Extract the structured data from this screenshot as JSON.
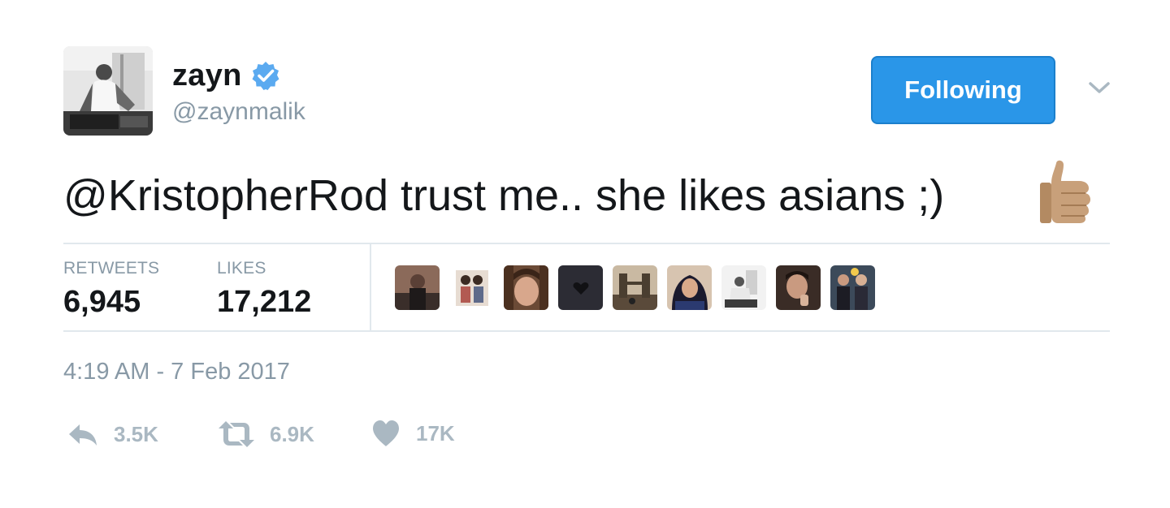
{
  "author": {
    "display_name": "zayn",
    "screen_name": "@zaynmalik",
    "verified_icon": "verified-badge-icon",
    "avatar": "profile-photo"
  },
  "header": {
    "follow_label": "Following",
    "follow_color": "#2a96e8",
    "menu_icon": "chevron-down-icon"
  },
  "tweet": {
    "mention": "@KristopherRod",
    "text": " trust me.. she likes asians ;)",
    "emoji": "thumbs-up-icon"
  },
  "stats": {
    "retweets_label": "RETWEETS",
    "retweets_value": "6,945",
    "likes_label": "LIKES",
    "likes_value": "17,212",
    "likers": [
      "liker-avatar-1",
      "liker-avatar-2",
      "liker-avatar-3",
      "liker-avatar-4",
      "liker-avatar-5",
      "liker-avatar-6",
      "liker-avatar-7",
      "liker-avatar-8",
      "liker-avatar-9"
    ]
  },
  "timestamp": "4:19 AM - 7 Feb 2017",
  "actions": {
    "reply_count": "3.5K",
    "retweet_count": "6.9K",
    "like_count": "17K",
    "icon_color": "#aab8c2"
  }
}
